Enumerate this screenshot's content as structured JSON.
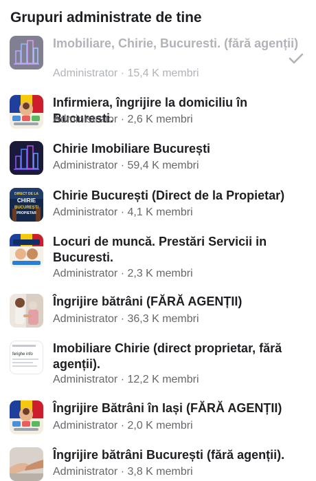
{
  "header": {
    "title": "Grupuri administrate de tine"
  },
  "groups": [
    {
      "name": "Imobiliare, Chirie, Bucuresti. (fără agenții)",
      "role": "Administrator",
      "members": "15,4 K membri",
      "icon": "city-skyline-thumbnail",
      "selected": true
    },
    {
      "name": "Infirmiera, îngrijire la domiciliu în Bucuresti.",
      "role": "Administrator",
      "members": "2,6 K membri",
      "icon": "flag-collage-thumbnail",
      "selected": false
    },
    {
      "name": "Chirie Imobiliare București",
      "role": "Administrator",
      "members": "59,4 K membri",
      "icon": "city-skyline-thumbnail",
      "selected": false
    },
    {
      "name": "Chirie București (Direct de la Propietar)",
      "role": "Administrator",
      "members": "4,1 K membri",
      "icon": "chirie-poster-thumbnail",
      "selected": false
    },
    {
      "name": "Locuri de muncă. Prestări Servicii in Bucuresti.",
      "role": "Administrator",
      "members": "2,3 K membri",
      "icon": "jobs-collage-thumbnail",
      "selected": false
    },
    {
      "name": "Îngrijire bătrâni (FĂRĂ AGENȚII)",
      "role": "Administrator",
      "members": "36,3 K membri",
      "icon": "caregiver-photo-thumbnail",
      "selected": false
    },
    {
      "name": "Imobiliare Chirie (direct proprietar, fără agenții).",
      "role": "Administrator",
      "members": "12,2 K membri",
      "icon": "text-page-thumbnail",
      "selected": false
    },
    {
      "name": "Îngrijire Bătrâni în Iași (FĂRĂ AGENȚII)",
      "role": "Administrator",
      "members": "2,0 K membri",
      "icon": "flag-collage-thumbnail",
      "selected": false
    },
    {
      "name": "Îngrijire bătrâni București (fără agenții).",
      "role": "Administrator",
      "members": "3,8 K membri",
      "icon": "holding-hands-thumbnail",
      "selected": false
    }
  ],
  "separator": "·",
  "thumb_text": {
    "g3_line1": "DIRECT DE LA",
    "g3_line2": "CHIRIE",
    "g3_line3": "BUCUREȘTI",
    "g3_line4": "PROPIETAR",
    "g6_line1": "ferighe info"
  },
  "colors": {
    "text_primary": "#1c1e21",
    "text_secondary": "#65676b",
    "text_disabled": "#b0b3b8",
    "check": "#b0b3b8"
  }
}
